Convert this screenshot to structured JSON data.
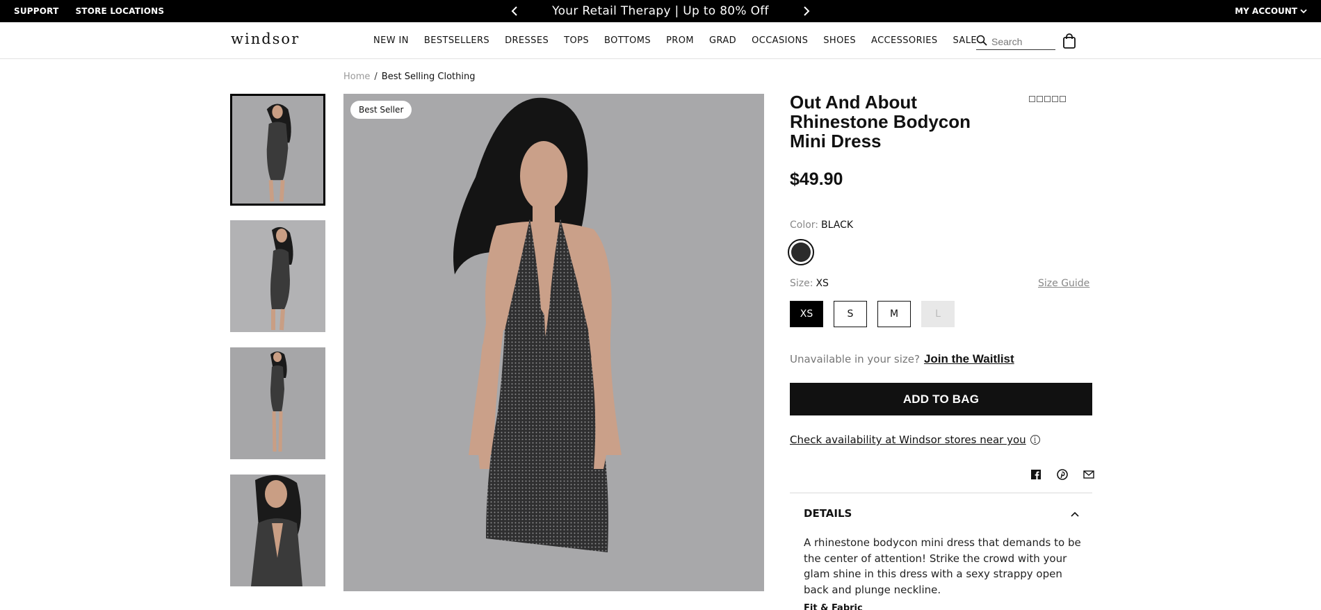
{
  "topbar": {
    "support_label": "SUPPORT",
    "stores_label": "STORE LOCATIONS",
    "promo_text": "Your Retail Therapy | Up to 80% Off",
    "account_label": "MY ACCOUNT"
  },
  "header": {
    "logo": "windsor",
    "nav": [
      "NEW IN",
      "BESTSELLERS",
      "DRESSES",
      "TOPS",
      "BOTTOMS",
      "PROM",
      "GRAD",
      "OCCASIONS",
      "SHOES",
      "ACCESSORIES",
      "SALE"
    ],
    "search_placeholder": "Search"
  },
  "breadcrumb": {
    "home": "Home",
    "separator": "/",
    "current": "Best Selling Clothing"
  },
  "gallery": {
    "badge": "Best Seller",
    "thumb_count": 4,
    "active_thumb": 1
  },
  "product": {
    "title": "Out And About Rhinestone Bodycon Mini Dress",
    "rating_stars": 5,
    "price": "$49.90",
    "color_label": "Color:",
    "color_value": "BLACK",
    "swatch_color": "#2b2b2b",
    "size_label": "Size:",
    "size_value": "XS",
    "size_guide": "Size Guide",
    "sizes": [
      {
        "label": "XS",
        "state": "selected"
      },
      {
        "label": "S",
        "state": "available"
      },
      {
        "label": "M",
        "state": "available"
      },
      {
        "label": "L",
        "state": "unavailable"
      }
    ],
    "waitlist_question": "Unavailable in your size?",
    "waitlist_link": "Join the Waitlist",
    "add_to_bag": "ADD TO BAG",
    "availability": "Check availability at Windsor stores near you",
    "info_icon": "i",
    "share_icons": [
      "facebook-icon",
      "pinterest-icon",
      "email-icon"
    ]
  },
  "details": {
    "heading": "DETAILS",
    "description": "A rhinestone bodycon mini dress that demands to be the center of attention! Strike the crowd with your glam shine in this dress with a sexy strappy open back and plunge neckline.",
    "next_section": "Fit & Fabric"
  }
}
